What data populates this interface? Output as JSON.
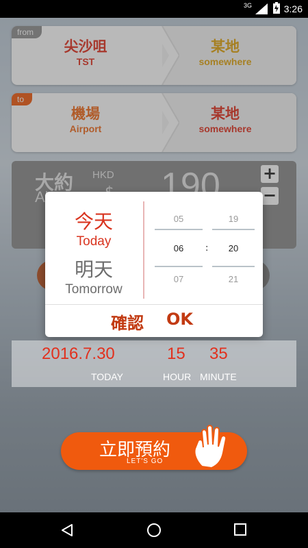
{
  "status_bar": {
    "network": "3G",
    "time": "3:26"
  },
  "route": {
    "from": {
      "tag": "from",
      "origin_zh": "尖沙咀",
      "origin_en": "TST",
      "dest_zh": "某地",
      "dest_en": "somewhere"
    },
    "to": {
      "tag": "to",
      "origin_zh": "機場",
      "origin_en": "Airport",
      "dest_zh": "某地",
      "dest_en": "somewhere"
    }
  },
  "fare": {
    "label_zh": "大約",
    "label_en": "About",
    "currency": "HKD",
    "symbol": "$",
    "amount": "190",
    "plus": "+",
    "minus": "−"
  },
  "dialog": {
    "today_zh": "今天",
    "today_en": "Today",
    "tomorrow_zh": "明天",
    "tomorrow_en": "Tomorrow",
    "hour_prev": "05",
    "hour_selected": "06",
    "hour_next": "07",
    "separator": ":",
    "minute_prev": "19",
    "minute_selected": "20",
    "minute_next": "21",
    "confirm_label": "確認",
    "ok_label": "OK"
  },
  "schedule": {
    "date_value": "2016.7.30",
    "date_label": "TODAY",
    "hour_value": "15",
    "hour_label": "HOUR",
    "minute_value": "35",
    "minute_label": "MINUTE"
  },
  "go_button": {
    "label_zh": "立即預約",
    "label_en": "LET'S GO"
  },
  "colors": {
    "accent": "#f05a0e",
    "orange_text": "#f06a1a",
    "red_text": "#e2301d",
    "gold_text": "#e0a30e",
    "tag_grey": "#8e8e8e"
  }
}
